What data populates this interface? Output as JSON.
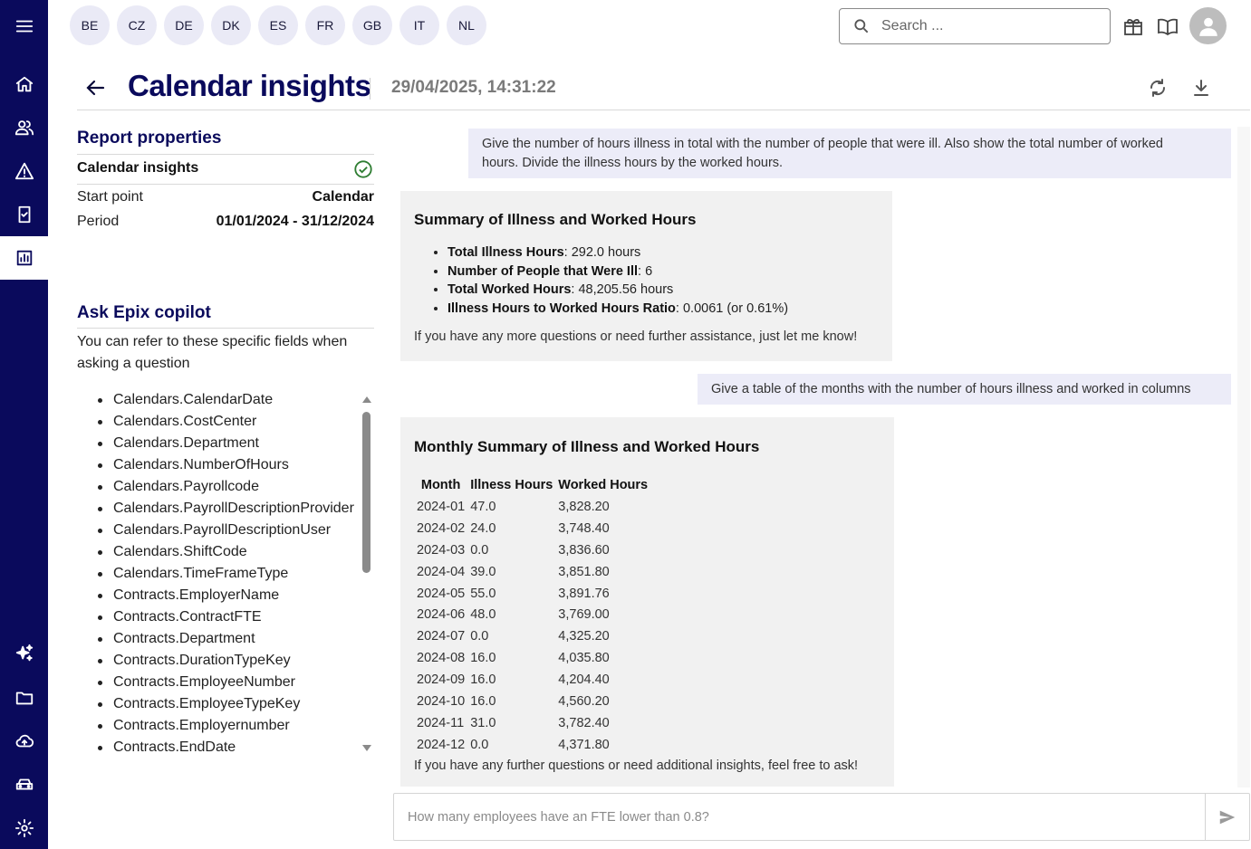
{
  "rail": {
    "items": [
      {
        "icon": "menu-icon"
      },
      {
        "icon": "home-icon"
      },
      {
        "icon": "people-icon"
      },
      {
        "icon": "warning-icon"
      },
      {
        "icon": "checklist-icon"
      },
      {
        "icon": "bar-chart-icon",
        "active": true
      },
      {
        "icon": "sparkle-icon"
      },
      {
        "icon": "folder-icon"
      },
      {
        "icon": "cloud-upload-icon"
      },
      {
        "icon": "car-icon"
      },
      {
        "icon": "settings-icon"
      }
    ]
  },
  "countries": [
    "BE",
    "CZ",
    "DE",
    "DK",
    "ES",
    "FR",
    "GB",
    "IT",
    "NL"
  ],
  "search": {
    "placeholder": "Search ..."
  },
  "top_icons": [
    "gift-icon",
    "book-icon",
    "avatar-icon"
  ],
  "header": {
    "title": "Calendar insights",
    "timestamp": "29/04/2025, 14:31:22",
    "actions": [
      "refresh-icon",
      "download-icon"
    ]
  },
  "report": {
    "heading": "Report properties",
    "name": "Calendar insights",
    "status_icon": "check-circle-icon",
    "start_point_label": "Start point",
    "start_point_value": "Calendar",
    "period_label": "Period",
    "period_value": "01/01/2024 - 31/12/2024"
  },
  "copilot": {
    "heading": "Ask Epix copilot",
    "help_line1": "You can refer to these specific fields when",
    "help_line2": "asking a question",
    "fields": [
      "Calendars.CalendarDate",
      "Calendars.CostCenter",
      "Calendars.Department",
      "Calendars.NumberOfHours",
      "Calendars.Payrollcode",
      "Calendars.PayrollDescriptionProvider",
      "Calendars.PayrollDescriptionUser",
      "Calendars.ShiftCode",
      "Calendars.TimeFrameType",
      "Contracts.EmployerName",
      "Contracts.ContractFTE",
      "Contracts.Department",
      "Contracts.DurationTypeKey",
      "Contracts.EmployeeNumber",
      "Contracts.EmployeeTypeKey",
      "Contracts.Employernumber",
      "Contracts.EndDate"
    ]
  },
  "chat": {
    "q1_line1": "Give the number of hours illness in total with the number of people that were ill. Also show the total number of worked",
    "q1_line2": "hours. Divide the illness hours by the worked hours.",
    "a1": {
      "heading": "Summary of Illness and Worked Hours",
      "items": [
        {
          "label": "Total Illness Hours",
          "value": ": 292.0 hours"
        },
        {
          "label": "Number of People that Were Ill",
          "value": ": 6"
        },
        {
          "label": "Total Worked Hours",
          "value": ": 48,205.56 hours"
        },
        {
          "label": "Illness Hours to Worked Hours Ratio",
          "value": ": 0.0061 (or 0.61%)"
        }
      ],
      "tail": "If you have any more questions or need further assistance, just let me know!"
    },
    "q2": "Give a table of the months with the number of hours illness and worked in columns",
    "a2": {
      "heading": "Monthly Summary of Illness and Worked Hours",
      "columns": [
        "Month",
        "Illness Hours",
        "Worked Hours"
      ],
      "rows": [
        [
          "2024-01",
          "47.0",
          "3,828.20"
        ],
        [
          "2024-02",
          "24.0",
          "3,748.40"
        ],
        [
          "2024-03",
          "0.0",
          "3,836.60"
        ],
        [
          "2024-04",
          "39.0",
          "3,851.80"
        ],
        [
          "2024-05",
          "55.0",
          "3,891.76"
        ],
        [
          "2024-06",
          "48.0",
          "3,769.00"
        ],
        [
          "2024-07",
          "0.0",
          "4,325.20"
        ],
        [
          "2024-08",
          "16.0",
          "4,035.80"
        ],
        [
          "2024-09",
          "16.0",
          "4,204.40"
        ],
        [
          "2024-10",
          "16.0",
          "4,560.20"
        ],
        [
          "2024-11",
          "31.0",
          "3,782.40"
        ],
        [
          "2024-12",
          "0.0",
          "4,371.80"
        ]
      ],
      "tail": "If you have any further questions or need additional insights, feel free to ask!"
    },
    "input_placeholder": "How many employees have an FTE lower than 0.8?",
    "send_icon": "send-icon"
  }
}
